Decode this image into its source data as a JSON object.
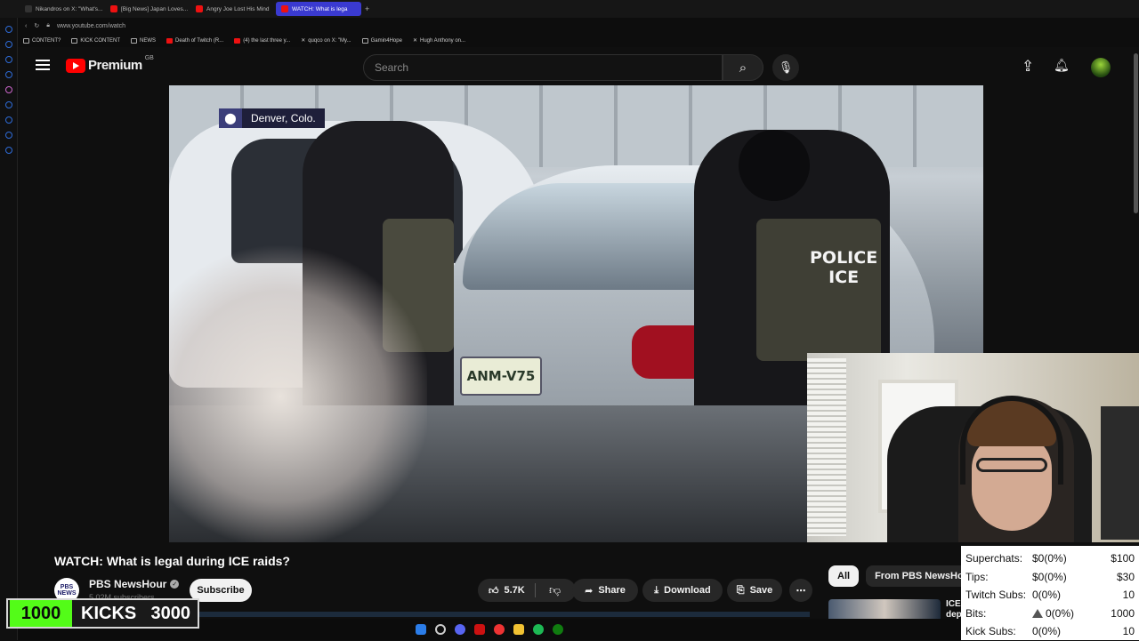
{
  "browser": {
    "tabs": [
      {
        "label": "Nikandros on X: \"What's..."
      },
      {
        "label": "[Big News] Japan Loves..."
      },
      {
        "label": "Angry Joe Lost His Mind"
      },
      {
        "label": "WATCH: What is lega"
      }
    ],
    "new_tab": "+",
    "url": "www.youtube.com/watch",
    "bookmarks": [
      "CONTENT?",
      "KICK CONTENT",
      "NEWS",
      "Death of Twitch (R...",
      "(4) the last three y...",
      "quqco on X: \"My...",
      "Gamin4Hope",
      "Hugh Anthony on..."
    ]
  },
  "youtube": {
    "logo_text": "Premium",
    "region": "GB",
    "search_placeholder": "Search",
    "video": {
      "location_label": "Denver, Colo.",
      "vest_text_line1": "POLICE",
      "vest_text_line2": "ICE",
      "plate_text": "ANM-V75"
    },
    "title": "WATCH: What is legal during ICE raids?",
    "channel": {
      "logo_line1": "PBS",
      "logo_line2": "NEWS",
      "name": "PBS NewsHour",
      "verified_mark": "✓",
      "subscribers": "5.02M subscribers",
      "subscribe_label": "Subscribe"
    },
    "actions": {
      "likes": "5.7K",
      "share": "Share",
      "download": "Download",
      "save": "Save"
    },
    "chips": [
      "All",
      "From PBS NewsHour"
    ],
    "next_video_title": "ICE\ndep"
  },
  "overlay": {
    "kicks_current": "1000",
    "kicks_label": "KICKS",
    "kicks_goal": "3000",
    "stats": [
      {
        "label": "Superchats:",
        "value": "$0(0%)",
        "goal": "$100"
      },
      {
        "label": "Tips:",
        "value": "$0(0%)",
        "goal": "$30"
      },
      {
        "label": "Twitch Subs:",
        "value": "0(0%)",
        "goal": "10"
      },
      {
        "label": "Bits:",
        "value": "0(0%)",
        "goal": "1000"
      },
      {
        "label": "Kick Subs:",
        "value": "0(0%)",
        "goal": "10"
      }
    ]
  },
  "colors": {
    "youtube_red": "#ff0000",
    "kick_green": "#53fc18",
    "active_tab": "#3a3ad0"
  }
}
